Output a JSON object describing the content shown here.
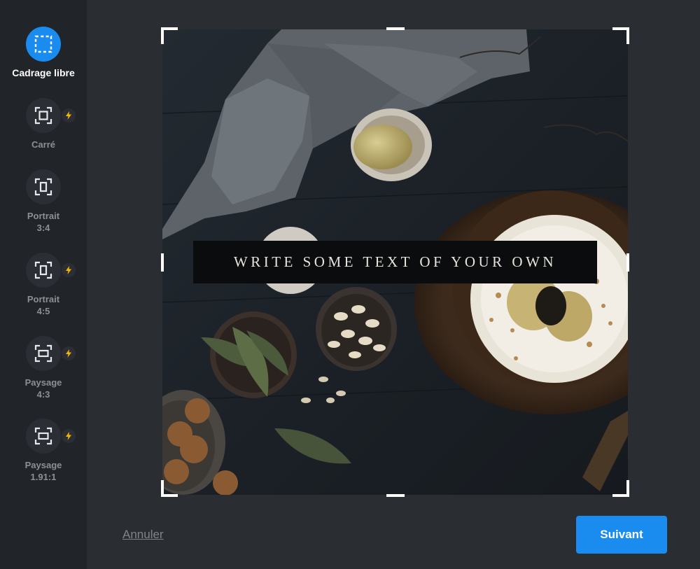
{
  "sidebar": {
    "items": [
      {
        "label": "Cadrage libre",
        "icon": "free-crop-icon",
        "active": true,
        "premium": false
      },
      {
        "label": "Carré",
        "icon": "square-crop-icon",
        "active": false,
        "premium": true
      },
      {
        "label": "Portrait\n3:4",
        "icon": "portrait-crop-icon",
        "active": false,
        "premium": false
      },
      {
        "label": "Portrait\n4:5",
        "icon": "portrait-crop-icon",
        "active": false,
        "premium": true
      },
      {
        "label": "Paysage\n4:3",
        "icon": "landscape-crop-icon",
        "active": false,
        "premium": true
      },
      {
        "label": "Paysage\n1.91:1",
        "icon": "landscape-crop-icon",
        "active": false,
        "premium": true
      }
    ]
  },
  "canvas": {
    "overlay_text": "WRITE SOME TEXT OF YOUR OWN"
  },
  "footer": {
    "cancel_label": "Annuler",
    "next_label": "Suivant"
  },
  "colors": {
    "accent": "#1a8cf0",
    "premium_bolt": "#f5b800",
    "background": "#2a2e33",
    "sidebar": "#212428"
  }
}
